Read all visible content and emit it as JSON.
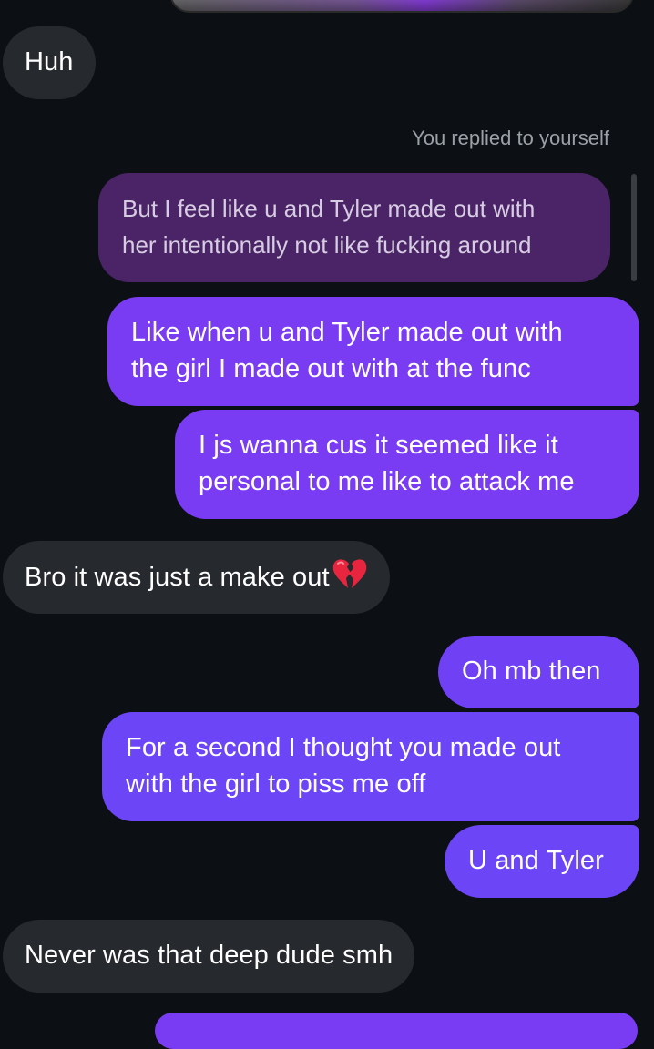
{
  "thread": {
    "colors": {
      "background": "#0c1014",
      "incoming_bubble": "#262a2f",
      "outgoing_bubble": "#7a3cf2",
      "outgoing_bubble_blue": "#6b45f6",
      "reply_quote": "#4a2466"
    },
    "messages": [
      {
        "sender": "other",
        "text": "Huh"
      },
      {
        "sender": "me",
        "reply_label": "You replied to yourself",
        "quoted_text_line1": "But I feel like u and Tyler made out with",
        "quoted_text_line2": "her intentionally not like fucking around"
      },
      {
        "sender": "me",
        "line1": "Like when u and Tyler made out with",
        "line2": "the girl I made out with at the func"
      },
      {
        "sender": "me",
        "line1": "I js wanna cus it seemed like it",
        "line2": "personal to me like to attack me"
      },
      {
        "sender": "other",
        "text": "Bro it was just a make out",
        "emoji": "broken-heart-icon"
      },
      {
        "sender": "me",
        "text": "Oh mb then"
      },
      {
        "sender": "me",
        "line1": "For a second I thought you made out",
        "line2": "with the girl to piss me off"
      },
      {
        "sender": "me",
        "text": "U and Tyler"
      },
      {
        "sender": "other",
        "text": "Never was that deep dude smh"
      }
    ]
  }
}
